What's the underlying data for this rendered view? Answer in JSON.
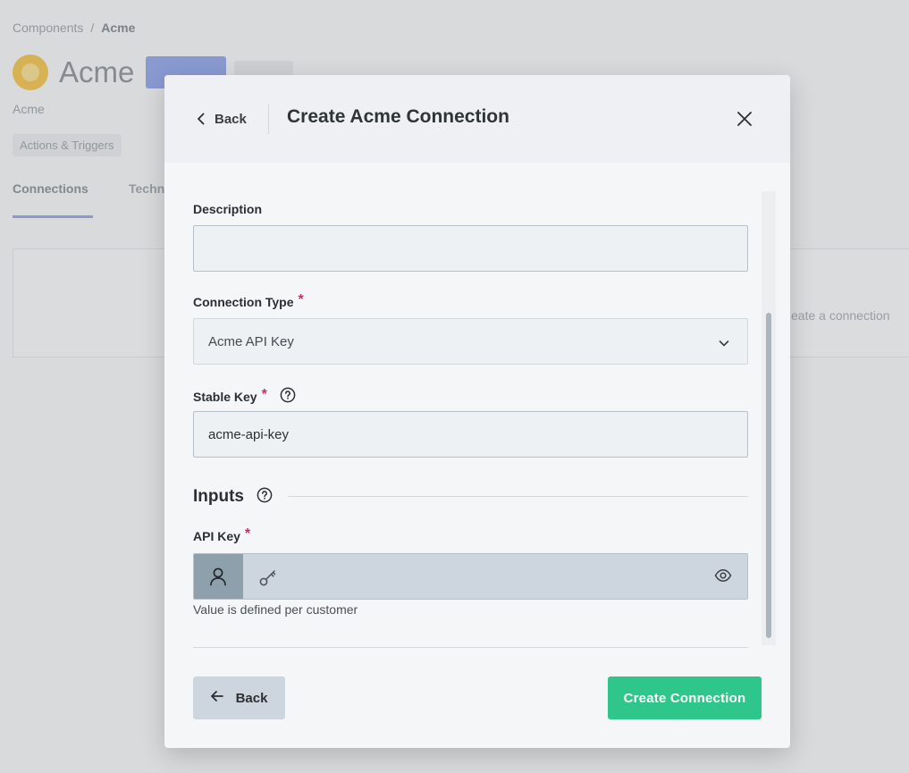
{
  "background": {
    "breadcrumb": {
      "root": "Components",
      "separator": "/",
      "current": "Acme"
    },
    "title": "Acme",
    "subtitle": "Acme",
    "chip": "Actions & Triggers",
    "tabs": [
      "Connections",
      "Techn"
    ],
    "panel_text": "eate a connection"
  },
  "modal": {
    "back_label": "Back",
    "title": "Create Acme Connection",
    "fields": {
      "description": {
        "label": "Description",
        "value": ""
      },
      "connection_type": {
        "label": "Connection Type",
        "required_mark": "*",
        "value": "Acme API Key"
      },
      "stable_key": {
        "label": "Stable Key",
        "required_mark": "*",
        "value": "acme-api-key"
      }
    },
    "inputs_section": {
      "title": "Inputs"
    },
    "api_key": {
      "label": "API Key",
      "required_mark": "*",
      "hint": "Value is defined per customer"
    },
    "footer": {
      "back_label": "Back",
      "create_label": "Create Connection"
    }
  },
  "colors": {
    "primary_green": "#2ec68a",
    "required_red": "#e0245e",
    "secondary_button": "#cdd6de",
    "per_customer_toggle": "#8fa0ad"
  },
  "icons": {
    "back": "chevron-left-icon",
    "close": "close-icon",
    "dropdown": "chevron-down-icon",
    "help": "question-circle-icon",
    "per_customer": "user-icon",
    "key": "key-icon",
    "visibility": "eye-icon",
    "footer_back": "arrow-left-icon"
  }
}
